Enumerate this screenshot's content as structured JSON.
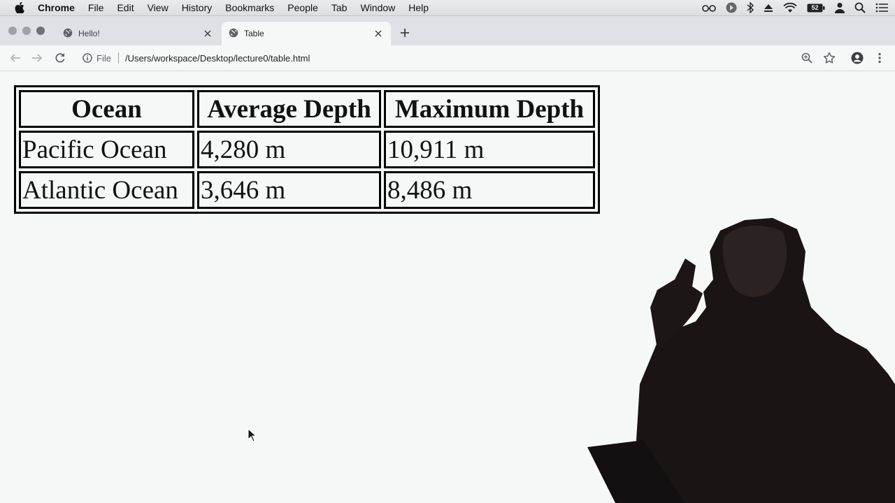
{
  "menubar": {
    "items": [
      "Chrome",
      "File",
      "Edit",
      "View",
      "History",
      "Bookmarks",
      "People",
      "Tab",
      "Window",
      "Help"
    ],
    "battery": "52"
  },
  "tabs": [
    {
      "title": "Hello!",
      "active": false
    },
    {
      "title": "Table",
      "active": true
    }
  ],
  "toolbar": {
    "scheme_label": "File",
    "url": "/Users/workspace/Desktop/lecture0/table.html"
  },
  "table": {
    "headers": [
      "Ocean",
      "Average Depth",
      "Maximum Depth"
    ],
    "rows": [
      [
        "Pacific Ocean",
        "4,280 m",
        "10,911 m"
      ],
      [
        "Atlantic Ocean",
        "3,646 m",
        "8,486 m"
      ]
    ]
  },
  "colors": {
    "accent": "#5f6368",
    "page_background": "#f6f8f8",
    "tabstrip": "#dee1e6"
  }
}
